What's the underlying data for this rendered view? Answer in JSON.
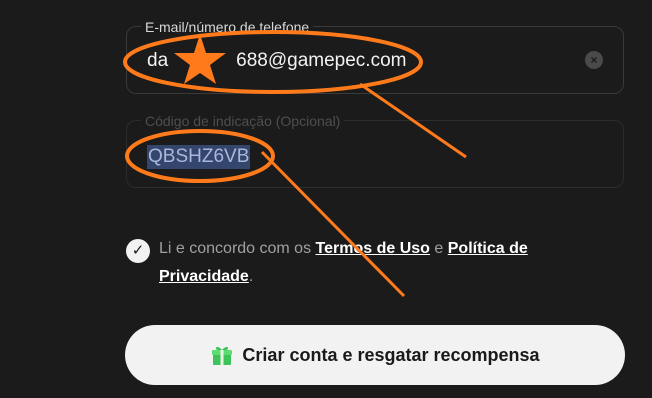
{
  "email_field": {
    "label": "E-mail/número de telefone",
    "value_start": "da",
    "value_end": "688@gamepec.com",
    "clear_icon": "clear-icon"
  },
  "code_field": {
    "label": "Código de indicação (Opcional)",
    "value": "QBSHZ6VB"
  },
  "terms": {
    "prefix": "Li e concordo com os",
    "terms_link": "Termos de Uso",
    "conjunction": "e",
    "privacy_link": "Política de Privacidade",
    "suffix": ".",
    "checked": true
  },
  "cta": {
    "label": "Criar conta e resgatar recompensa",
    "icon": "gift-icon"
  },
  "colors": {
    "background": "#1b1b1b",
    "annotation": "#ff7a1a",
    "cta_bg": "#f2f2f2",
    "selection": "#35466e"
  }
}
